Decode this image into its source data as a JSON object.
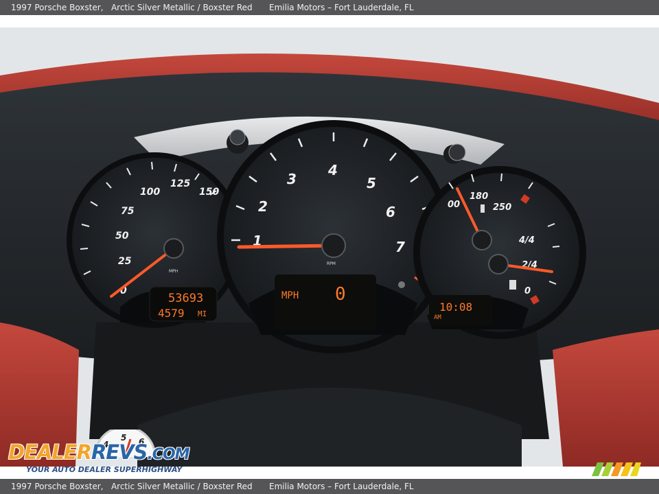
{
  "listing": {
    "title": "1997 Porsche Boxster,",
    "color": "Arctic Silver Metallic / Boxster Red",
    "dealer": "Emilia Motors – Fort Lauderdale, FL"
  },
  "gauges": {
    "speedometer": {
      "unit": "MPH",
      "ticks": [
        "25",
        "50",
        "75",
        "100",
        "125",
        "150"
      ],
      "needle_value_mph": 0
    },
    "tachometer": {
      "unit": "RPM",
      "ticks": [
        "1",
        "2",
        "3",
        "4",
        "5",
        "6",
        "7"
      ],
      "needle_value": 1
    },
    "combo": {
      "temp_ticks": [
        "180",
        "250"
      ],
      "temp_partial": "00",
      "fuel_ticks": [
        "0",
        "2/4",
        "4/4"
      ]
    }
  },
  "displays": {
    "odometer": "53693",
    "trip": "4579",
    "trip_unit": "MI",
    "speed_label": "MPH",
    "speed_value": "0",
    "clock": "10:08",
    "clock_ampm": "AM"
  },
  "watermark": {
    "brand_dealer": "DEALER",
    "brand_revs": "REVS",
    "brand_com": ".COM",
    "tagline": "YOUR AUTO DEALER SUPERHIGHWAY",
    "mini_gauge_ticks": [
      "4",
      "5",
      "6"
    ]
  },
  "colors": {
    "needle": "#ff5a2a",
    "lcd": "#ff7a2a",
    "leather": "#b23a30",
    "dash": "#23272b",
    "bar": "#555557"
  }
}
